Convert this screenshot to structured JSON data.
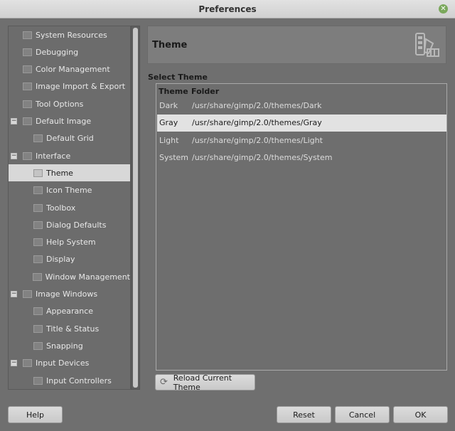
{
  "window": {
    "title": "Preferences",
    "close_icon": "close-icon"
  },
  "sidebar": {
    "items": [
      {
        "label": "System Resources",
        "icon": "system-resources-icon",
        "level": 0,
        "expander": ""
      },
      {
        "label": "Debugging",
        "icon": "debugging-icon",
        "level": 0,
        "expander": ""
      },
      {
        "label": "Color Management",
        "icon": "color-management-icon",
        "level": 0,
        "expander": ""
      },
      {
        "label": "Image Import & Export",
        "icon": "image-import-export-icon",
        "level": 0,
        "expander": ""
      },
      {
        "label": "Tool Options",
        "icon": "tool-options-icon",
        "level": 0,
        "expander": ""
      },
      {
        "label": "Default Image",
        "icon": "default-image-icon",
        "level": 0,
        "expander": "−"
      },
      {
        "label": "Default Grid",
        "icon": "default-grid-icon",
        "level": 1,
        "expander": ""
      },
      {
        "label": "Interface",
        "icon": "interface-icon",
        "level": 0,
        "expander": "−"
      },
      {
        "label": "Theme",
        "icon": "theme-icon",
        "level": 1,
        "expander": "",
        "selected": true
      },
      {
        "label": "Icon Theme",
        "icon": "icon-theme-icon",
        "level": 1,
        "expander": ""
      },
      {
        "label": "Toolbox",
        "icon": "toolbox-icon",
        "level": 1,
        "expander": ""
      },
      {
        "label": "Dialog Defaults",
        "icon": "dialog-defaults-icon",
        "level": 1,
        "expander": ""
      },
      {
        "label": "Help System",
        "icon": "help-system-icon",
        "level": 1,
        "expander": ""
      },
      {
        "label": "Display",
        "icon": "display-icon",
        "level": 1,
        "expander": ""
      },
      {
        "label": "Window Management",
        "icon": "window-management-icon",
        "level": 1,
        "expander": ""
      },
      {
        "label": "Image Windows",
        "icon": "image-windows-icon",
        "level": 0,
        "expander": "−"
      },
      {
        "label": "Appearance",
        "icon": "appearance-icon",
        "level": 1,
        "expander": ""
      },
      {
        "label": "Title & Status",
        "icon": "title-status-icon",
        "level": 1,
        "expander": ""
      },
      {
        "label": "Snapping",
        "icon": "snapping-icon",
        "level": 1,
        "expander": ""
      },
      {
        "label": "Input Devices",
        "icon": "input-devices-icon",
        "level": 0,
        "expander": "−"
      },
      {
        "label": "Input Controllers",
        "icon": "input-controllers-icon",
        "level": 1,
        "expander": ""
      }
    ]
  },
  "panel": {
    "title": "Theme",
    "icon": "theme-palette-icon",
    "section_label": "Select Theme",
    "columns": [
      "Theme",
      "Folder"
    ],
    "rows": [
      {
        "theme": "Dark",
        "folder": "/usr/share/gimp/2.0/themes/Dark"
      },
      {
        "theme": "Gray",
        "folder": "/usr/share/gimp/2.0/themes/Gray",
        "selected": true
      },
      {
        "theme": "Light",
        "folder": "/usr/share/gimp/2.0/themes/Light"
      },
      {
        "theme": "System",
        "folder": "/usr/share/gimp/2.0/themes/System"
      }
    ],
    "reload_label": "Reload Current Theme",
    "reload_icon": "reload-icon"
  },
  "footer": {
    "help_label": "Help",
    "reset_label": "Reset",
    "cancel_label": "Cancel",
    "ok_label": "OK"
  }
}
